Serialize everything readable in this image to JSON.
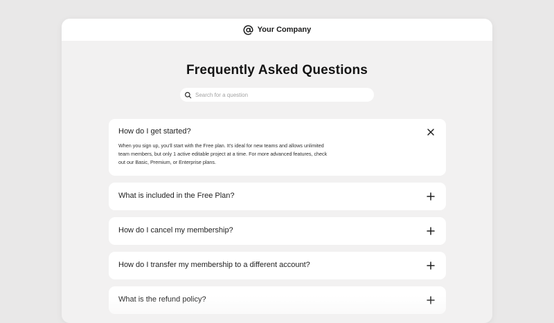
{
  "header": {
    "company_name": "Your Company",
    "logo_icon": "at-sign-icon"
  },
  "main": {
    "title": "Frequently Asked Questions",
    "search": {
      "placeholder": "Search for a question",
      "value": "",
      "icon": "search-icon"
    }
  },
  "faq": {
    "items": [
      {
        "question": "How do I get started?",
        "answer": "When you sign up, you'll start with the Free plan. It's ideal for new teams and allows unlimited team members, but only 1 active editable project at a time. For more advanced features, check out our Basic,  Premium, or Enterprise plans.",
        "expanded": true,
        "toggle_icon": "close-icon"
      },
      {
        "question": "What is included in the Free Plan?",
        "expanded": false,
        "toggle_icon": "plus-icon"
      },
      {
        "question": "How do I cancel my membership?",
        "expanded": false,
        "toggle_icon": "plus-icon"
      },
      {
        "question": "How do I transfer my membership to a different account?",
        "expanded": false,
        "toggle_icon": "plus-icon"
      },
      {
        "question": "What is the refund policy?",
        "expanded": false,
        "toggle_icon": "plus-icon"
      }
    ]
  },
  "colors": {
    "background": "#e9e8e8",
    "panel": "#f2f1f1",
    "card": "#ffffff",
    "text": "#1b1b1b"
  }
}
